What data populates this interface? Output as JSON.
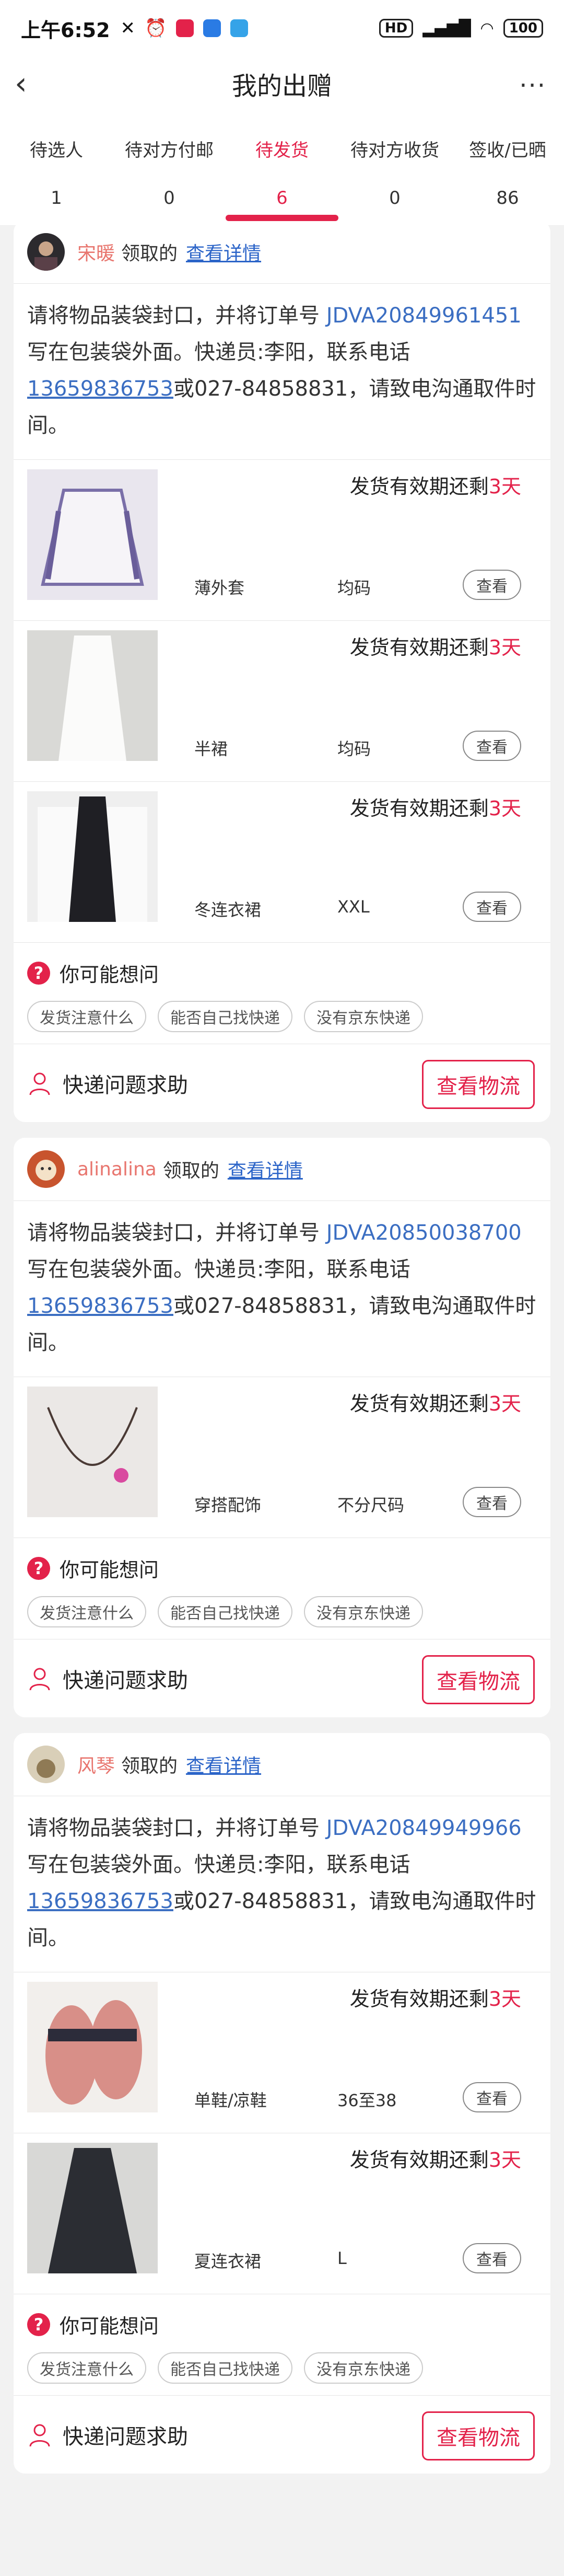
{
  "status_bar": {
    "time": "上午6:52",
    "battery": "100",
    "hd": "HD"
  },
  "header": {
    "title": "我的出赠"
  },
  "tabs": [
    {
      "label": "待选人",
      "count": "1"
    },
    {
      "label": "待对方付邮",
      "count": "0"
    },
    {
      "label": "待发货",
      "count": "6"
    },
    {
      "label": "待对方收货",
      "count": "0"
    },
    {
      "label": "签收/已晒",
      "count": "86"
    }
  ],
  "common": {
    "claimed": "领取的",
    "view_detail": "查看详情",
    "deadline_prefix": "发货有效期还剩",
    "view": "查看",
    "faq_title": "你可能想问",
    "chips": [
      "发货注意什么",
      "能否自己找快递",
      "没有京东快递"
    ],
    "help": "快递问题求助",
    "logistics": "查看物流"
  },
  "orders": [
    {
      "nickname": "宋暖",
      "notice_a": "请将物品装袋封口，并将订单号 ",
      "order_no": "JDVA20849961451",
      "notice_b": " 写在包装袋外面。快递员:李阳，联系电话",
      "phone": "13659836753",
      "notice_c": "或027-84858831，请致电沟通取件时间。",
      "items": [
        {
          "name": "薄外套",
          "size": "均码",
          "days": "3天"
        },
        {
          "name": "半裙",
          "size": "均码",
          "days": "3天"
        },
        {
          "name": "冬连衣裙",
          "size": "XXL",
          "days": "3天"
        }
      ]
    },
    {
      "nickname": "alinalina",
      "notice_a": "请将物品装袋封口，并将订单号 ",
      "order_no": "JDVA20850038700",
      "notice_b": " 写在包装袋外面。快递员:李阳，联系电话",
      "phone": "13659836753",
      "notice_c": "或027-84858831，请致电沟通取件时间。",
      "items": [
        {
          "name": "穿搭配饰",
          "size": "不分尺码",
          "days": "3天"
        }
      ]
    },
    {
      "nickname": "风琴",
      "notice_a": "请将物品装袋封口，并将订单号 ",
      "order_no": "JDVA20849949966",
      "notice_b": " 写在包装袋外面。快递员:李阳，联系电话",
      "phone": "13659836753",
      "notice_c": "或027-84858831，请致电沟通取件时间。",
      "items": [
        {
          "name": "单鞋/凉鞋",
          "size": "36至38",
          "days": "3天"
        },
        {
          "name": "夏连衣裙",
          "size": "L",
          "days": "3天"
        }
      ]
    }
  ],
  "colors": {
    "accent": "#e3224a",
    "link": "#3b6ec2"
  }
}
